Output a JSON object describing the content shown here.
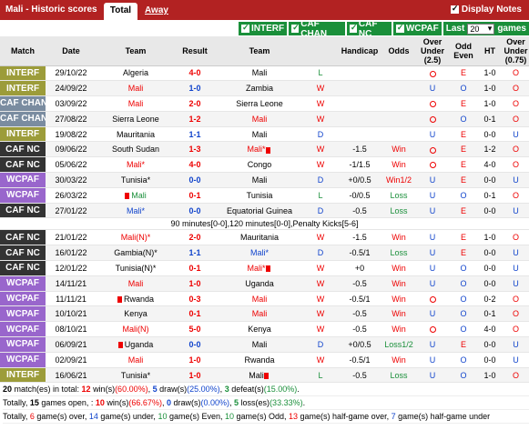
{
  "header": {
    "title": "Mali - Historic scores",
    "tab_total": "Total",
    "tab_away": "Away",
    "display_notes": "Display Notes"
  },
  "filters": {
    "items": [
      "INTERF",
      "CAF CHAN",
      "CAF NC",
      "WCPAF"
    ],
    "last_label": "Last",
    "last_value": "20",
    "games_label": "games"
  },
  "columns": {
    "match": "Match",
    "date": "Date",
    "team1": "Team",
    "result": "Result",
    "team2": "Team",
    "handicap": "Handicap",
    "odds": "Odds",
    "over_under": "Over Under (2.5)",
    "odd_even": "Odd Even",
    "ht": "HT",
    "ou075": "Over Under (0.75)"
  },
  "colors": {
    "INTERF": "#9c9c3a",
    "CAF CHAN": "#7a8ca0",
    "CAF NC": "#333333",
    "WCPAF": "#9966cc"
  },
  "rows": [
    {
      "comp": "INTERF",
      "date": "29/10/22",
      "home": "Algeria",
      "hc": "",
      "score": "4-0",
      "sc": "red",
      "away": "Mali",
      "ac": "",
      "r": "L",
      "rc": "green",
      "hcap": "",
      "odds": "",
      "oc": "",
      "ou": "circle",
      "oe": "E",
      "ht": "1-0",
      "ou2": "O"
    },
    {
      "comp": "INTERF",
      "date": "24/09/22",
      "home": "Mali",
      "hc": "red",
      "score": "1-0",
      "sc": "blue",
      "away": "Zambia",
      "ac": "",
      "r": "W",
      "rc": "red",
      "hcap": "",
      "odds": "",
      "oc": "",
      "ou": "U",
      "oe": "O",
      "ht": "1-0",
      "ou2": "O"
    },
    {
      "comp": "CAF CHAN",
      "date": "03/09/22",
      "home": "Mali",
      "hc": "red",
      "score": "2-0",
      "sc": "red",
      "away": "Sierra Leone",
      "ac": "",
      "r": "W",
      "rc": "red",
      "hcap": "",
      "odds": "",
      "oc": "",
      "ou": "circle",
      "oe": "E",
      "ht": "1-0",
      "ou2": "O"
    },
    {
      "comp": "CAF CHAN",
      "date": "27/08/22",
      "home": "Sierra Leone",
      "hc": "",
      "score": "1-2",
      "sc": "red",
      "away": "Mali",
      "ac": "red",
      "r": "W",
      "rc": "red",
      "hcap": "",
      "odds": "",
      "oc": "",
      "ou": "circle",
      "oe": "O",
      "ht": "0-1",
      "ou2": "O"
    },
    {
      "comp": "INTERF",
      "date": "19/08/22",
      "home": "Mauritania",
      "hc": "",
      "score": "1-1",
      "sc": "blue",
      "away": "Mali",
      "ac": "",
      "r": "D",
      "rc": "blue",
      "hcap": "",
      "odds": "",
      "oc": "",
      "ou": "U",
      "oe": "E",
      "ht": "0-0",
      "ou2": "U"
    },
    {
      "comp": "CAF NC",
      "date": "09/06/22",
      "home": "South Sudan",
      "hc": "",
      "score": "1-3",
      "sc": "red",
      "away": "Mali*",
      "ac": "red",
      "acard": true,
      "r": "W",
      "rc": "red",
      "hcap": "-1.5",
      "odds": "Win",
      "oc": "red",
      "ou": "circle",
      "oe": "E",
      "ht": "1-2",
      "ou2": "O"
    },
    {
      "comp": "CAF NC",
      "date": "05/06/22",
      "home": "Mali*",
      "hc": "red",
      "score": "4-0",
      "sc": "red",
      "away": "Congo",
      "ac": "",
      "r": "W",
      "rc": "red",
      "hcap": "-1/1.5",
      "odds": "Win",
      "oc": "red",
      "ou": "circle",
      "oe": "E",
      "ht": "4-0",
      "ou2": "O"
    },
    {
      "comp": "WCPAF",
      "date": "30/03/22",
      "home": "Tunisia*",
      "hc": "",
      "score": "0-0",
      "sc": "blue",
      "away": "Mali",
      "ac": "",
      "r": "D",
      "rc": "blue",
      "hcap": "+0/0.5",
      "odds": "Win1/2",
      "oc": "red",
      "ou": "U",
      "oe": "E",
      "ht": "0-0",
      "ou2": "U"
    },
    {
      "comp": "WCPAF",
      "date": "26/03/22",
      "home": "Mali",
      "hc": "green",
      "hcard": true,
      "score": "0-1",
      "sc": "red",
      "away": "Tunisia",
      "ac": "",
      "r": "L",
      "rc": "green",
      "hcap": "-0/0.5",
      "odds": "Loss",
      "oc": "green",
      "ou": "U",
      "oe": "O",
      "ht": "0-1",
      "ou2": "O"
    },
    {
      "comp": "CAF NC",
      "date": "27/01/22",
      "home": "Mali*",
      "hc": "blue",
      "score": "0-0",
      "sc": "blue",
      "away": "Equatorial Guinea",
      "ac": "",
      "r": "D",
      "rc": "blue",
      "hcap": "-0.5",
      "odds": "Loss",
      "oc": "green",
      "ou": "U",
      "oe": "E",
      "ht": "0-0",
      "ou2": "U"
    },
    {
      "note": "90 minutes[0-0],120 minutes[0-0],Penalty Kicks[5-6]"
    },
    {
      "comp": "CAF NC",
      "date": "21/01/22",
      "home": "Mali(N)*",
      "hc": "red",
      "score": "2-0",
      "sc": "red",
      "away": "Mauritania",
      "ac": "",
      "r": "W",
      "rc": "red",
      "hcap": "-1.5",
      "odds": "Win",
      "oc": "red",
      "ou": "U",
      "oe": "E",
      "ht": "1-0",
      "ou2": "O"
    },
    {
      "comp": "CAF NC",
      "date": "16/01/22",
      "home": "Gambia(N)*",
      "hc": "",
      "score": "1-1",
      "sc": "blue",
      "away": "Mali*",
      "ac": "blue",
      "r": "D",
      "rc": "blue",
      "hcap": "-0.5/1",
      "odds": "Loss",
      "oc": "green",
      "ou": "U",
      "oe": "E",
      "ht": "0-0",
      "ou2": "U"
    },
    {
      "comp": "CAF NC",
      "date": "12/01/22",
      "home": "Tunisia(N)*",
      "hc": "",
      "score": "0-1",
      "sc": "red",
      "away": "Mali*",
      "ac": "red",
      "acard": true,
      "r": "W",
      "rc": "red",
      "hcap": "+0",
      "odds": "Win",
      "oc": "red",
      "ou": "U",
      "oe": "O",
      "ht": "0-0",
      "ou2": "U"
    },
    {
      "comp": "WCPAF",
      "date": "14/11/21",
      "home": "Mali",
      "hc": "red",
      "score": "1-0",
      "sc": "red",
      "away": "Uganda",
      "ac": "",
      "r": "W",
      "rc": "red",
      "hcap": "-0.5",
      "odds": "Win",
      "oc": "red",
      "ou": "U",
      "oe": "O",
      "ht": "0-0",
      "ou2": "U"
    },
    {
      "comp": "WCPAF",
      "date": "11/11/21",
      "home": "Rwanda",
      "hc": "",
      "hcard": true,
      "score": "0-3",
      "sc": "red",
      "away": "Mali",
      "ac": "red",
      "r": "W",
      "rc": "red",
      "hcap": "-0.5/1",
      "odds": "Win",
      "oc": "red",
      "ou": "circle",
      "oe": "O",
      "ht": "0-2",
      "ou2": "O"
    },
    {
      "comp": "WCPAF",
      "date": "10/10/21",
      "home": "Kenya",
      "hc": "",
      "score": "0-1",
      "sc": "red",
      "away": "Mali",
      "ac": "red",
      "r": "W",
      "rc": "red",
      "hcap": "-0.5",
      "odds": "Win",
      "oc": "red",
      "ou": "U",
      "oe": "O",
      "ht": "0-1",
      "ou2": "O"
    },
    {
      "comp": "WCPAF",
      "date": "08/10/21",
      "home": "Mali(N)",
      "hc": "red",
      "score": "5-0",
      "sc": "red",
      "away": "Kenya",
      "ac": "",
      "r": "W",
      "rc": "red",
      "hcap": "-0.5",
      "odds": "Win",
      "oc": "red",
      "ou": "circle",
      "oe": "O",
      "ht": "4-0",
      "ou2": "O"
    },
    {
      "comp": "WCPAF",
      "date": "06/09/21",
      "home": "Uganda",
      "hc": "",
      "hcard": true,
      "score": "0-0",
      "sc": "blue",
      "away": "Mali",
      "ac": "",
      "r": "D",
      "rc": "blue",
      "hcap": "+0/0.5",
      "odds": "Loss1/2",
      "oc": "green",
      "ou": "U",
      "oe": "E",
      "ht": "0-0",
      "ou2": "U"
    },
    {
      "comp": "WCPAF",
      "date": "02/09/21",
      "home": "Mali",
      "hc": "red",
      "score": "1-0",
      "sc": "red",
      "away": "Rwanda",
      "ac": "",
      "r": "W",
      "rc": "red",
      "hcap": "-0.5/1",
      "odds": "Win",
      "oc": "red",
      "ou": "U",
      "oe": "O",
      "ht": "0-0",
      "ou2": "U"
    },
    {
      "comp": "INTERF",
      "date": "16/06/21",
      "home": "Tunisia*",
      "hc": "",
      "score": "1-0",
      "sc": "red",
      "away": "Mali",
      "ac": "",
      "acard": true,
      "r": "L",
      "rc": "green",
      "hcap": "-0.5",
      "odds": "Loss",
      "oc": "green",
      "ou": "U",
      "oe": "O",
      "ht": "1-0",
      "ou2": "O"
    }
  ],
  "summary": {
    "line1": [
      {
        "t": "20",
        "b": true
      },
      {
        "t": " match(es) in total: "
      },
      {
        "t": "12",
        "b": true,
        "c": "red"
      },
      {
        "t": " win(s)"
      },
      {
        "t": "(60.00%)",
        "c": "red"
      },
      {
        "t": ", "
      },
      {
        "t": "5",
        "b": true,
        "c": "blue"
      },
      {
        "t": " draw(s)"
      },
      {
        "t": "(25.00%)",
        "c": "blue"
      },
      {
        "t": ", "
      },
      {
        "t": "3",
        "b": true,
        "c": "green"
      },
      {
        "t": " defeat(s)"
      },
      {
        "t": "(15.00%)",
        "c": "green"
      },
      {
        "t": "."
      }
    ],
    "line2": [
      {
        "t": "Totally, "
      },
      {
        "t": "15",
        "b": true
      },
      {
        "t": " games open, : "
      },
      {
        "t": "10",
        "b": true,
        "c": "red"
      },
      {
        "t": " win(s)"
      },
      {
        "t": "(66.67%)",
        "c": "red"
      },
      {
        "t": ", "
      },
      {
        "t": "0",
        "b": true,
        "c": "blue"
      },
      {
        "t": " draw(s)"
      },
      {
        "t": "(0.00%)",
        "c": "blue"
      },
      {
        "t": ", "
      },
      {
        "t": "5",
        "b": true,
        "c": "green"
      },
      {
        "t": " loss(es)"
      },
      {
        "t": "(33.33%)",
        "c": "green"
      },
      {
        "t": "."
      }
    ],
    "line3": [
      {
        "t": "Totally, "
      },
      {
        "t": "6",
        "c": "red"
      },
      {
        "t": " game(s) over, "
      },
      {
        "t": "14",
        "c": "blue"
      },
      {
        "t": " game(s) under, "
      },
      {
        "t": "10",
        "c": "green"
      },
      {
        "t": " game(s) Even, "
      },
      {
        "t": "10",
        "c": "green"
      },
      {
        "t": " game(s) Odd, "
      },
      {
        "t": "13",
        "c": "red"
      },
      {
        "t": " game(s) half-game over, "
      },
      {
        "t": "7",
        "c": "blue"
      },
      {
        "t": " game(s) half-game under"
      }
    ]
  }
}
